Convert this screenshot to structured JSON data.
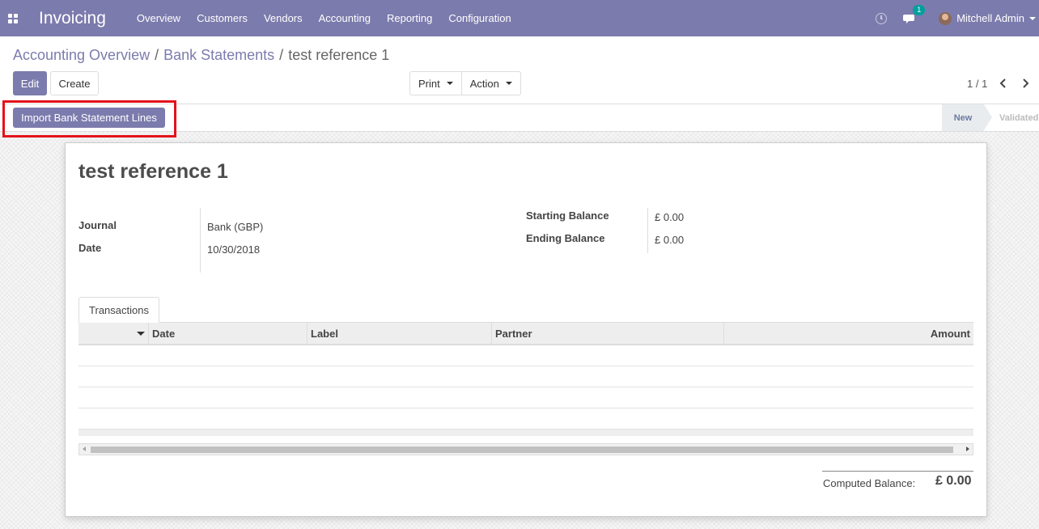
{
  "navbar": {
    "app_name": "Invoicing",
    "menu": [
      "Overview",
      "Customers",
      "Vendors",
      "Accounting",
      "Reporting",
      "Configuration"
    ],
    "chat_badge": "1",
    "user_name": "Mitchell Admin",
    "bg_color": "#7c7bad"
  },
  "breadcrumb": {
    "items": [
      "Accounting Overview",
      "Bank Statements"
    ],
    "current": "test reference 1",
    "separator": "/"
  },
  "toolbar": {
    "edit_label": "Edit",
    "create_label": "Create",
    "print_label": "Print",
    "action_label": "Action",
    "pager": "1 / 1"
  },
  "statusbar": {
    "import_label": "Import Bank Statement Lines",
    "stages": [
      "New",
      "Validated"
    ],
    "current_stage": "New",
    "highlight_color": "#e4121b"
  },
  "record": {
    "title": "test reference 1",
    "journal_label": "Journal",
    "journal_value": "Bank (GBP)",
    "date_label": "Date",
    "date_value": "10/30/2018",
    "starting_balance_label": "Starting Balance",
    "starting_balance_value": "£ 0.00",
    "ending_balance_label": "Ending Balance",
    "ending_balance_value": "£ 0.00"
  },
  "transactions": {
    "tab_label": "Transactions",
    "columns": [
      "Date",
      "Label",
      "Partner",
      "Amount"
    ],
    "rows": []
  },
  "footer": {
    "computed_label": "Computed Balance:",
    "computed_value": "£ 0.00"
  }
}
